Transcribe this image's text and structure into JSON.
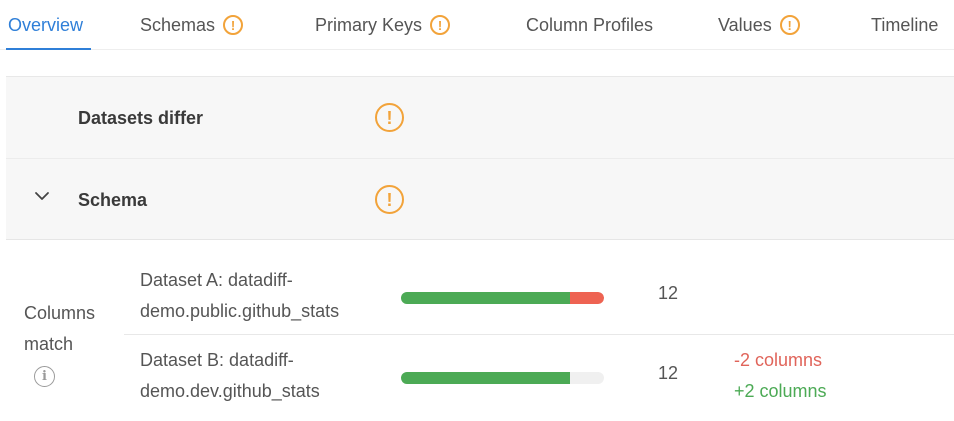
{
  "tabs": [
    {
      "label": "Overview",
      "active": true,
      "warning": false
    },
    {
      "label": "Schemas",
      "active": false,
      "warning": true
    },
    {
      "label": "Primary Keys",
      "active": false,
      "warning": true
    },
    {
      "label": "Column Profiles",
      "active": false,
      "warning": false
    },
    {
      "label": "Values",
      "active": false,
      "warning": true
    },
    {
      "label": "Timeline",
      "active": false,
      "warning": false
    }
  ],
  "summary": {
    "datasets_differ_label": "Datasets differ",
    "schema_label": "Schema"
  },
  "columns_match": {
    "label": "Columns match",
    "datasets": [
      {
        "name": "Dataset A: datadiff-demo.public.github_stats",
        "count": "12",
        "match_fraction": 0.833,
        "mismatch_fraction": 0.167
      },
      {
        "name": "Dataset B: datadiff-demo.dev.github_stats",
        "count": "12",
        "match_fraction": 0.833,
        "mismatch_fraction": 0
      }
    ],
    "removed_text": "-2 columns",
    "added_text": "+2 columns"
  },
  "colors": {
    "accent": "#2f7fd8",
    "warning": "#f2a33a",
    "match": "#4caa55",
    "mismatch": "#ee6352",
    "removed_text": "#e0645a"
  },
  "icons": {
    "warning": "exclamation-circle",
    "expand": "chevron-down",
    "info": "info-circle"
  },
  "glyphs": {
    "warning": "!",
    "info": "i"
  }
}
